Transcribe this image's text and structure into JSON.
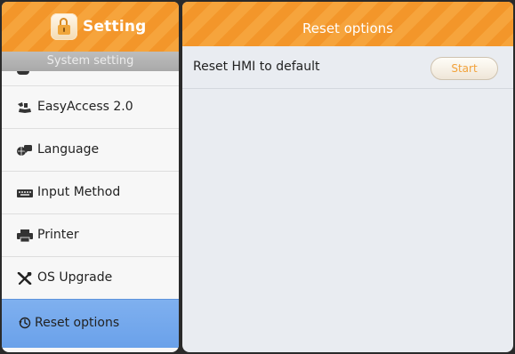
{
  "app": {
    "title": "Setting",
    "icon": "lock-icon"
  },
  "sidebar": {
    "section_title": "System setting",
    "items": [
      {
        "label": "EasyAccess 2.0",
        "icon": "easyaccess-icon"
      },
      {
        "label": "Language",
        "icon": "language-icon"
      },
      {
        "label": "Input Method",
        "icon": "keyboard-icon"
      },
      {
        "label": "Printer",
        "icon": "printer-icon"
      },
      {
        "label": "OS Upgrade",
        "icon": "tools-icon"
      },
      {
        "label": "Reset options",
        "icon": "reset-icon",
        "selected": true
      }
    ]
  },
  "main": {
    "title": "Reset options",
    "rows": [
      {
        "label": "Reset HMI to default",
        "button_label": "Start"
      }
    ]
  },
  "colors": {
    "header_orange": "#f6a43c",
    "selected_blue": "#7fb0ef",
    "start_text": "#f2a23a"
  }
}
